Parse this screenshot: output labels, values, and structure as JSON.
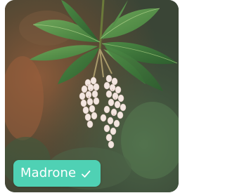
{
  "identification": {
    "label": "Madrone",
    "status_icon": "check-icon"
  },
  "colors": {
    "chip_background": "#4fd1b4",
    "chip_text": "#ffffff"
  }
}
